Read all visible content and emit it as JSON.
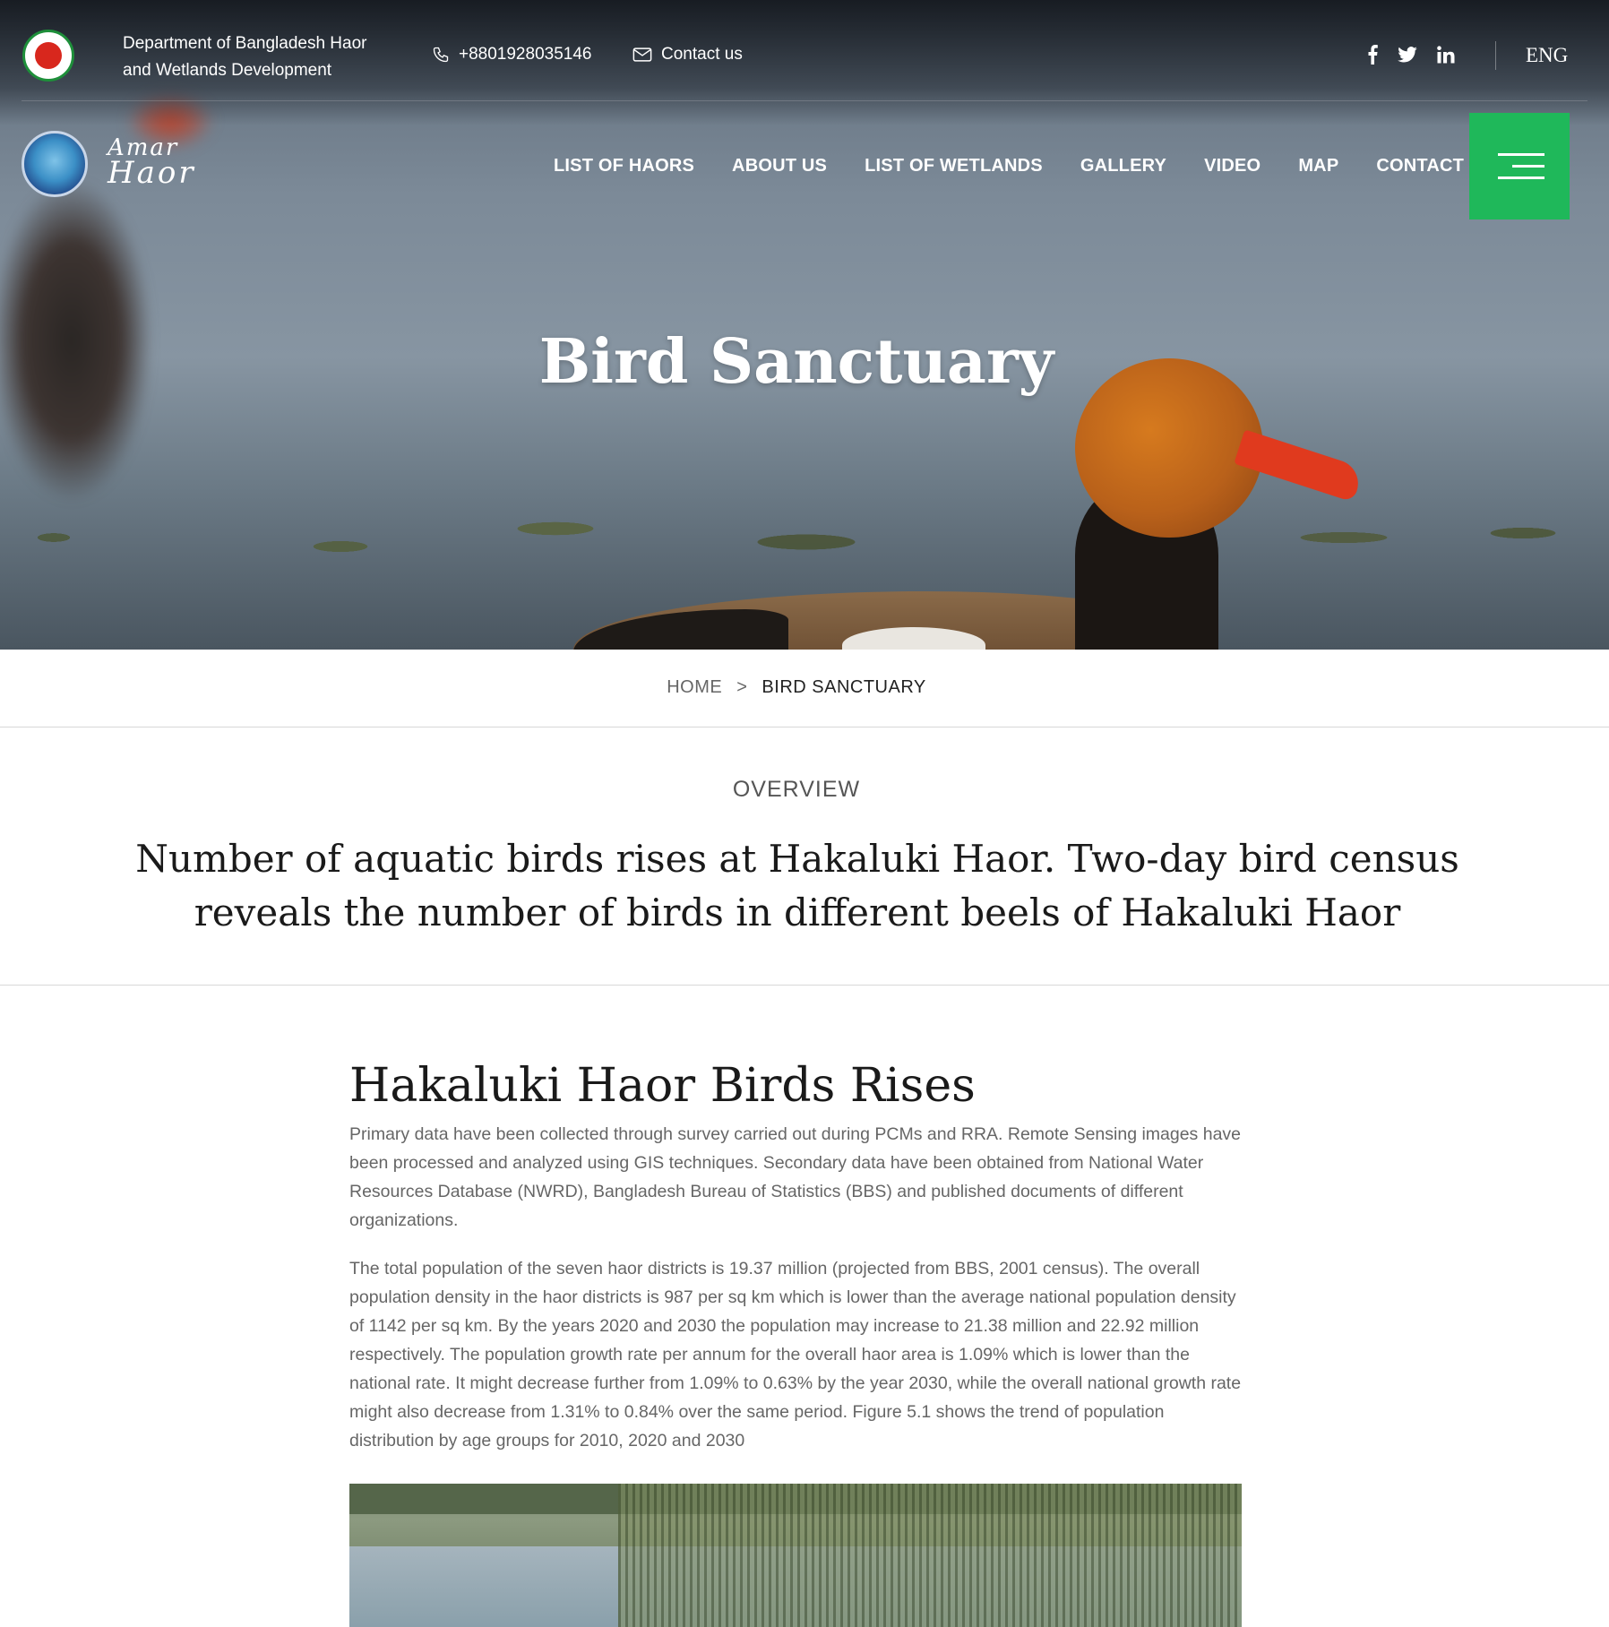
{
  "topbar": {
    "department_line1": "Department of Bangladesh Haor",
    "department_line2": "and Wetlands Development",
    "phone": "+8801928035146",
    "contact": "Contact us",
    "social": [
      "f",
      "twitter",
      "in"
    ],
    "language": "ENG"
  },
  "logo": {
    "line1": "Amar",
    "line2": "Haor"
  },
  "nav": {
    "items": [
      "LIST OF HAORS",
      "ABOUT US",
      "LIST OF WETLANDS",
      "GALLERY",
      "VIDEO",
      "MAP",
      "CONTACT US"
    ]
  },
  "hero": {
    "title": "Bird Sanctuary"
  },
  "breadcrumb": {
    "home": "HOME",
    "separator": ">",
    "current": "BIRD SANCTUARY"
  },
  "overview": {
    "label": "OVERVIEW",
    "headline": "Number of aquatic birds rises at Hakaluki Haor. Two-day bird census reveals the number of birds in different beels of Hakaluki Haor"
  },
  "article": {
    "title": "Hakaluki Haor Birds Rises",
    "paragraphs": [
      "Primary data have been collected through survey carried out during PCMs and RRA. Remote Sensing images have been processed and analyzed using GIS techniques. Secondary data have been obtained from National Water Resources Database (NWRD), Bangladesh Bureau of Statistics (BBS) and published documents of different organizations.",
      "The total population of the seven haor districts is 19.37 million (projected from BBS, 2001 census). The overall population density in the haor districts is 987 per sq km which is lower than the average national population density of 1142 per sq km. By the years 2020 and 2030 the population may increase to 21.38 million and 22.92 million respectively. The population growth rate per annum for the overall haor area is 1.09% which is lower than the national rate. It might decrease further from 1.09% to 0.63% by the year 2030, while the overall national growth rate might also decrease from 1.31% to 0.84% over the same period. Figure 5.1 shows the trend of population distribution by age groups for 2010, 2020 and 2030"
    ]
  },
  "colors": {
    "accent": "#1fb85a",
    "text": "#1a1a1a",
    "muted": "#666666"
  }
}
